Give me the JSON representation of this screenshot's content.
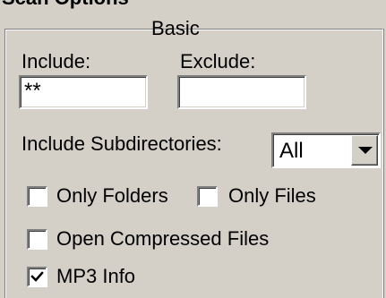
{
  "header": {
    "partial_title": "Scan Options"
  },
  "group": {
    "title": "Basic"
  },
  "include": {
    "label": "Include:",
    "value": "**"
  },
  "exclude": {
    "label": "Exclude:",
    "value": ""
  },
  "subdirectories": {
    "label": "Include Subdirectories:",
    "selected": "All",
    "icon": "chevron-down-icon"
  },
  "options": {
    "only_folders": {
      "label": "Only Folders",
      "checked": false
    },
    "only_files": {
      "label": "Only Files",
      "checked": false
    },
    "open_compressed": {
      "label": "Open Compressed Files",
      "checked": false
    },
    "mp3_info": {
      "label": "MP3 Info",
      "checked": true
    }
  },
  "colors": {
    "face": "#d4d0c8",
    "shadow": "#808080",
    "highlight": "#ffffff",
    "window": "#ffffff"
  }
}
